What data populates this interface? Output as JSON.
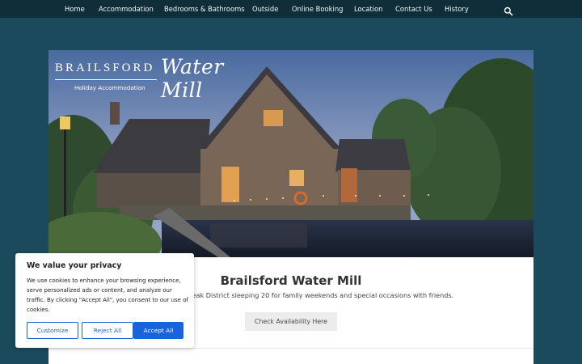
{
  "nav": {
    "items": [
      {
        "label": "Home",
        "active": true
      },
      {
        "label": "Accommodation"
      },
      {
        "label": "Bedrooms & Bathrooms"
      },
      {
        "label": "Outside"
      },
      {
        "label": "Online Booking"
      },
      {
        "label": "Location"
      },
      {
        "label": "Contact Us"
      },
      {
        "label": "History"
      }
    ],
    "search_icon": "search-icon"
  },
  "hero": {
    "brand_name": "BRAILSFORD",
    "brand_script": "Water Mill",
    "brand_sub": "Holiday Accommodation"
  },
  "main": {
    "title": "Brailsford Water Mill",
    "tagline": "shbourne and the Peak District sleeping 20 for family weekends and special occasions with friends.",
    "cta_label": "Check Availability Here"
  },
  "cookie": {
    "title": "We value your privacy",
    "text": "We use cookies to enhance your browsing experience, serve personalized ads or content, and analyze our traffic. By clicking \"Accept All\", you consent to our use of cookies.",
    "customize_label": "Customize",
    "reject_label": "Reject All",
    "accept_label": "Accept All"
  },
  "colors": {
    "page_bg": "#1a4a5c",
    "nav_bg": "#0f2e3a",
    "accent": "#1863dc"
  }
}
